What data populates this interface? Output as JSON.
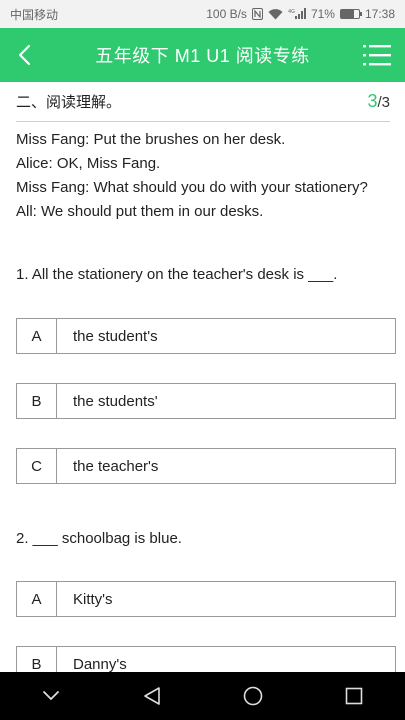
{
  "status_bar": {
    "carrier": "中国移动",
    "network_speed": "100 B/s",
    "signal_label": "4G",
    "battery": "71%",
    "battery_level": 0.71,
    "time": "17:38"
  },
  "header": {
    "title": "五年级下 M1 U1 阅读专练",
    "back_icon": "chevron-left-icon",
    "menu_icon": "list-menu-icon"
  },
  "section": {
    "title": "二、阅读理解。",
    "current": "3",
    "total": "/3"
  },
  "passage": [
    "Miss Fang: Put the brushes on her desk.",
    "Alice: OK, Miss Fang.",
    "Miss Fang: What should you do with your stationery?",
    "All: We should put them in our desks."
  ],
  "questions": [
    {
      "text": "1. All the stationery on the teacher's desk is ___.",
      "options": [
        {
          "letter": "A",
          "text": "the student's"
        },
        {
          "letter": "B",
          "text": "the students'"
        },
        {
          "letter": "C",
          "text": "the teacher's"
        }
      ]
    },
    {
      "text": "2. ___ schoolbag is blue.",
      "options": [
        {
          "letter": "A",
          "text": "Kitty's"
        },
        {
          "letter": "B",
          "text": "Danny's"
        }
      ]
    }
  ],
  "colors": {
    "accent": "#2fc96f",
    "status_bg": "#f2f2f2",
    "nav_bg": "#000000"
  }
}
